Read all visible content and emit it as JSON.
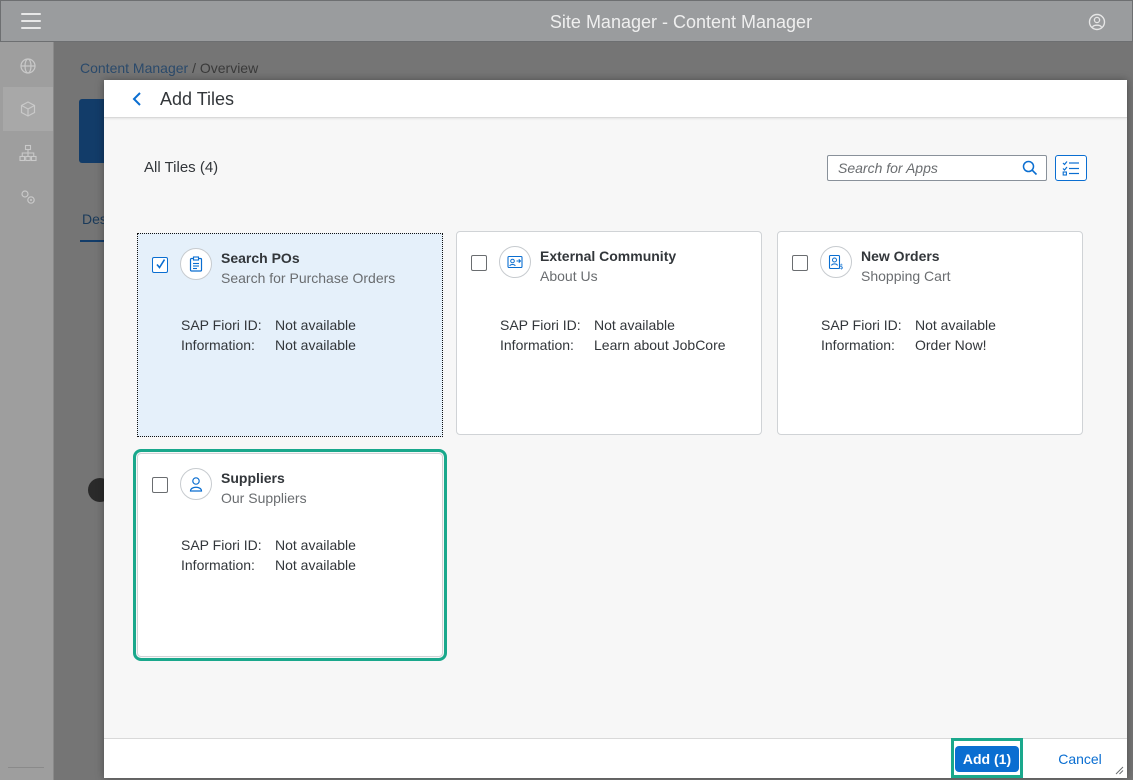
{
  "shell": {
    "title": "Site Manager - Content Manager"
  },
  "side_nav": {
    "items": [
      "globe-icon",
      "cube-icon",
      "hierarchy-icon",
      "settings-icon"
    ],
    "active_index": 1
  },
  "background": {
    "breadcrumb": {
      "link": "Content Manager",
      "separator": "/",
      "current": "Overview"
    },
    "tab_partial": "Des"
  },
  "dialog": {
    "title": "Add Tiles",
    "count_label": "All Tiles (4)",
    "search_placeholder": "Search for Apps",
    "labels": {
      "fiori_id": "SAP Fiori ID:",
      "information": "Information:"
    },
    "tiles": [
      {
        "title": "Search POs",
        "subtitle": "Search for Purchase Orders",
        "icon": "clipboard-icon",
        "checked": true,
        "fiori_id": "Not available",
        "information": "Not available"
      },
      {
        "title": "External Community",
        "subtitle": "About Us",
        "icon": "share-icon",
        "checked": false,
        "fiori_id": "Not available",
        "information": "Learn about JobCore"
      },
      {
        "title": "New Orders",
        "subtitle": "Shopping Cart",
        "icon": "order-icon",
        "checked": false,
        "fiori_id": "Not available",
        "information": "Order Now!"
      },
      {
        "title": "Suppliers",
        "subtitle": "Our Suppliers",
        "icon": "person-icon",
        "checked": false,
        "fiori_id": "Not available",
        "information": "Not available"
      }
    ],
    "footer": {
      "add_label": "Add (1)",
      "cancel_label": "Cancel"
    }
  },
  "colors": {
    "accent": "#0a6ed1",
    "highlight": "#1aa88c",
    "selected_tile": "#e5f0fa"
  }
}
